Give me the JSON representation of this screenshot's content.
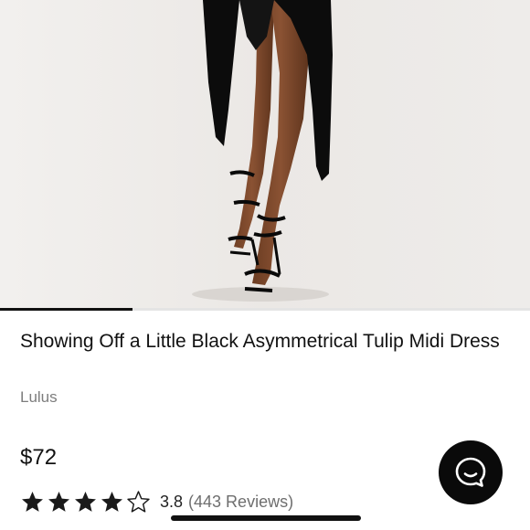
{
  "gallery": {
    "image_alt": "Model wearing black asymmetrical midi dress and strappy black heels",
    "slide_progress": 0.25
  },
  "product": {
    "title": "Showing Off a Little Black Asymmetrical Tulip Midi Dress",
    "brand": "Lulus",
    "price": "$72"
  },
  "rating": {
    "stars_filled": 4,
    "stars_total": 5,
    "value": "3.8",
    "reviews_label": "(443 Reviews)"
  },
  "chat": {
    "icon": "chat-bubble-icon"
  },
  "colors": {
    "text": "#111111",
    "muted": "#7d7d7d",
    "chat_button": "#0a0a0a",
    "background": "#ffffff"
  }
}
